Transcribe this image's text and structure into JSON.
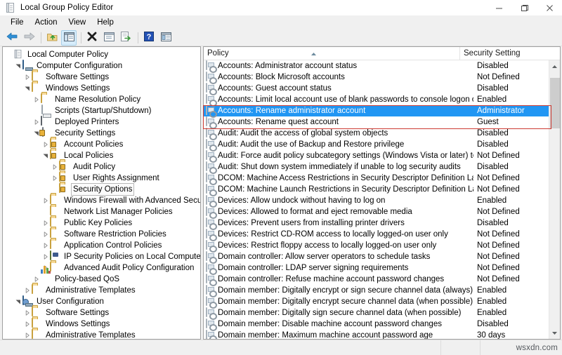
{
  "window": {
    "title": "Local Group Policy Editor",
    "app_icon": "policy-editor-icon",
    "minimize_label": "Minimize",
    "maximize_label": "Maximize",
    "close_label": "Close"
  },
  "menubar": {
    "items": [
      {
        "label": "File",
        "name": "menu-file"
      },
      {
        "label": "Action",
        "name": "menu-action"
      },
      {
        "label": "View",
        "name": "menu-view"
      },
      {
        "label": "Help",
        "name": "menu-help"
      }
    ]
  },
  "toolbar": {
    "buttons": [
      {
        "name": "back-button",
        "icon": "arrow-left-icon",
        "label": "Back",
        "enabled": true
      },
      {
        "name": "forward-button",
        "icon": "arrow-right-icon",
        "label": "Forward",
        "enabled": false
      },
      {
        "name": "up-one-level-button",
        "icon": "folder-up-icon",
        "label": "Up One Level",
        "enabled": true
      },
      {
        "name": "show-hide-tree-button",
        "icon": "show-tree-icon",
        "label": "Show/Hide Console Tree",
        "pressed": true
      },
      {
        "name": "delete-button",
        "icon": "delete-x-icon",
        "label": "Delete",
        "enabled": true
      },
      {
        "name": "properties-button",
        "icon": "properties-icon",
        "label": "Properties",
        "enabled": true
      },
      {
        "name": "export-list-button",
        "icon": "export-list-icon",
        "label": "Export List",
        "enabled": true
      },
      {
        "name": "help-button",
        "icon": "help-question-icon",
        "label": "Help",
        "enabled": true
      },
      {
        "name": "view-options-button",
        "icon": "view-options-icon",
        "label": "View",
        "enabled": true
      }
    ]
  },
  "tree": {
    "items": [
      {
        "label": "Local Computer Policy",
        "depth": 0,
        "twisty": "none",
        "icon": "policy-editor-icon",
        "selected": false
      },
      {
        "label": "Computer Configuration",
        "depth": 1,
        "twisty": "expanded",
        "icon": "computer-icon",
        "selected": false
      },
      {
        "label": "Software Settings",
        "depth": 2,
        "twisty": "collapsed",
        "icon": "folder-icon",
        "selected": false
      },
      {
        "label": "Windows Settings",
        "depth": 2,
        "twisty": "expanded",
        "icon": "folder-icon",
        "selected": false
      },
      {
        "label": "Name Resolution Policy",
        "depth": 3,
        "twisty": "collapsed",
        "icon": "folder-icon",
        "selected": false
      },
      {
        "label": "Scripts (Startup/Shutdown)",
        "depth": 3,
        "twisty": "none",
        "icon": "script-document-icon",
        "selected": false
      },
      {
        "label": "Deployed Printers",
        "depth": 3,
        "twisty": "collapsed",
        "icon": "printer-icon",
        "selected": false
      },
      {
        "label": "Security Settings",
        "depth": 3,
        "twisty": "expanded",
        "icon": "security-server-icon",
        "selected": false
      },
      {
        "label": "Account Policies",
        "depth": 4,
        "twisty": "collapsed",
        "icon": "folder-locked-icon",
        "selected": false
      },
      {
        "label": "Local Policies",
        "depth": 4,
        "twisty": "expanded",
        "icon": "folder-locked-icon",
        "selected": false
      },
      {
        "label": "Audit Policy",
        "depth": 5,
        "twisty": "collapsed",
        "icon": "folder-locked-icon",
        "selected": false
      },
      {
        "label": "User Rights Assignment",
        "depth": 5,
        "twisty": "collapsed",
        "icon": "folder-locked-icon",
        "selected": false
      },
      {
        "label": "Security Options",
        "depth": 5,
        "twisty": "none",
        "icon": "folder-locked-icon",
        "selected": true
      },
      {
        "label": "Windows Firewall with Advanced Security",
        "depth": 4,
        "twisty": "collapsed",
        "icon": "folder-icon",
        "selected": false
      },
      {
        "label": "Network List Manager Policies",
        "depth": 4,
        "twisty": "none",
        "icon": "folder-icon",
        "selected": false
      },
      {
        "label": "Public Key Policies",
        "depth": 4,
        "twisty": "collapsed",
        "icon": "folder-icon",
        "selected": false
      },
      {
        "label": "Software Restriction Policies",
        "depth": 4,
        "twisty": "collapsed",
        "icon": "folder-icon",
        "selected": false
      },
      {
        "label": "Application Control Policies",
        "depth": 4,
        "twisty": "collapsed",
        "icon": "folder-icon",
        "selected": false
      },
      {
        "label": "IP Security Policies on Local Computer",
        "depth": 4,
        "twisty": "collapsed",
        "icon": "ipsec-icon",
        "selected": false
      },
      {
        "label": "Advanced Audit Policy Configuration",
        "depth": 4,
        "twisty": "collapsed",
        "icon": "folder-icon",
        "selected": false
      },
      {
        "label": "Policy-based QoS",
        "depth": 3,
        "twisty": "collapsed",
        "icon": "qos-chart-icon",
        "selected": false
      },
      {
        "label": "Administrative Templates",
        "depth": 2,
        "twisty": "collapsed",
        "icon": "folder-icon",
        "selected": false
      },
      {
        "label": "User Configuration",
        "depth": 1,
        "twisty": "expanded",
        "icon": "user-config-icon",
        "selected": false
      },
      {
        "label": "Software Settings",
        "depth": 2,
        "twisty": "collapsed",
        "icon": "folder-icon",
        "selected": false
      },
      {
        "label": "Windows Settings",
        "depth": 2,
        "twisty": "collapsed",
        "icon": "folder-icon",
        "selected": false
      },
      {
        "label": "Administrative Templates",
        "depth": 2,
        "twisty": "collapsed",
        "icon": "folder-icon",
        "selected": false
      }
    ]
  },
  "list": {
    "columns": [
      {
        "label": "Policy",
        "name": "column-header-policy",
        "sorted": true,
        "sort_direction": "ascending"
      },
      {
        "label": "Security Setting",
        "name": "column-header-security-setting",
        "sorted": false
      }
    ],
    "rows": [
      {
        "policy": "Accounts: Administrator account status",
        "setting": "Disabled",
        "selected": false
      },
      {
        "policy": "Accounts: Block Microsoft accounts",
        "setting": "Not Defined",
        "selected": false
      },
      {
        "policy": "Accounts: Guest account status",
        "setting": "Disabled",
        "selected": false
      },
      {
        "policy": "Accounts: Limit local account use of blank passwords to console logon only",
        "setting": "Enabled",
        "selected": false
      },
      {
        "policy": "Accounts: Rename administrator account",
        "setting": "Administrator",
        "selected": true
      },
      {
        "policy": "Accounts: Rename quest account",
        "setting": "Guest",
        "selected": false
      },
      {
        "policy": "Audit: Audit the access of global system objects",
        "setting": "Disabled",
        "selected": false
      },
      {
        "policy": "Audit: Audit the use of Backup and Restore privilege",
        "setting": "Disabled",
        "selected": false
      },
      {
        "policy": "Audit: Force audit policy subcategory settings (Windows Vista or later) to ov...",
        "setting": "Not Defined",
        "selected": false
      },
      {
        "policy": "Audit: Shut down system immediately if unable to log security audits",
        "setting": "Disabled",
        "selected": false
      },
      {
        "policy": "DCOM: Machine Access Restrictions in Security Descriptor Definition Langua...",
        "setting": "Not Defined",
        "selected": false
      },
      {
        "policy": "DCOM: Machine Launch Restrictions in Security Descriptor Definition Langu...",
        "setting": "Not Defined",
        "selected": false
      },
      {
        "policy": "Devices: Allow undock without having to log on",
        "setting": "Enabled",
        "selected": false
      },
      {
        "policy": "Devices: Allowed to format and eject removable media",
        "setting": "Not Defined",
        "selected": false
      },
      {
        "policy": "Devices: Prevent users from installing printer drivers",
        "setting": "Disabled",
        "selected": false
      },
      {
        "policy": "Devices: Restrict CD-ROM access to locally logged-on user only",
        "setting": "Not Defined",
        "selected": false
      },
      {
        "policy": "Devices: Restrict floppy access to locally logged-on user only",
        "setting": "Not Defined",
        "selected": false
      },
      {
        "policy": "Domain controller: Allow server operators to schedule tasks",
        "setting": "Not Defined",
        "selected": false
      },
      {
        "policy": "Domain controller: LDAP server signing requirements",
        "setting": "Not Defined",
        "selected": false
      },
      {
        "policy": "Domain controller: Refuse machine account password changes",
        "setting": "Not Defined",
        "selected": false
      },
      {
        "policy": "Domain member: Digitally encrypt or sign secure channel data (always)",
        "setting": "Enabled",
        "selected": false
      },
      {
        "policy": "Domain member: Digitally encrypt secure channel data (when possible)",
        "setting": "Enabled",
        "selected": false
      },
      {
        "policy": "Domain member: Digitally sign secure channel data (when possible)",
        "setting": "Enabled",
        "selected": false
      },
      {
        "policy": "Domain member: Disable machine account password changes",
        "setting": "Disabled",
        "selected": false
      },
      {
        "policy": "Domain member: Maximum machine account password age",
        "setting": "30 days",
        "selected": false
      }
    ]
  },
  "annotation": {
    "highlight_color": "#cc3b33",
    "name": "red-highlight-box"
  },
  "statusbar": {
    "watermark": "wsxdn.com"
  },
  "colors": {
    "selection_blue": "#2196f3",
    "window_background": "#f0f0f0",
    "pane_background": "#ffffff",
    "highlight_red": "#cc3b33"
  }
}
